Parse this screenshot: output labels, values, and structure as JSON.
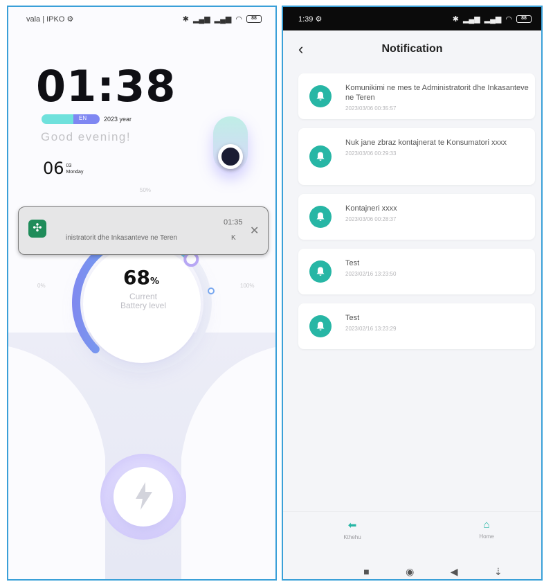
{
  "left_screen": {
    "status_bar": {
      "carrier": "vala | IPKO",
      "battery": "88"
    },
    "clock": "01:38",
    "lang_badge": "EN",
    "year_text": "2023 year",
    "greeting": "Good evening!",
    "date": {
      "day": "06",
      "month": "03",
      "weekday": "Monday"
    },
    "gauge": {
      "label_50": "50%",
      "label_0": "0%",
      "label_100": "100%",
      "percent": "68",
      "percent_unit": "%",
      "caption_line1": "Current",
      "caption_line2": "Battery level",
      "level": 0.68
    },
    "notification_banner": {
      "time": "01:35",
      "text": "inistratorit dhe Inkasanteve ne Teren",
      "suffix": "K"
    },
    "colors": {
      "accent_teal": "#6fe1dc",
      "accent_purple": "#7f87f2"
    }
  },
  "right_screen": {
    "status_bar": {
      "time": "1:39",
      "battery": "88"
    },
    "header": {
      "title": "Notification"
    },
    "notifications": [
      {
        "title": "Komunikimi ne mes te Administratorit dhe Inkasanteve ne Teren",
        "date": "2023/03/06 00:35:57"
      },
      {
        "title": "Nuk jane zbraz kontajnerat te Konsumatori xxxx",
        "date": "2023/03/06 00:29:33"
      },
      {
        "title": "Kontajneri xxxx",
        "date": "2023/03/06 00:28:37"
      },
      {
        "title": "Test",
        "date": "2023/02/16 13:23:50"
      },
      {
        "title": "Test",
        "date": "2023/02/16 13:23:29"
      }
    ],
    "bottom_nav": {
      "back_label": "Kthehu",
      "home_label": "Home"
    },
    "colors": {
      "accent": "#27b6a5"
    }
  }
}
